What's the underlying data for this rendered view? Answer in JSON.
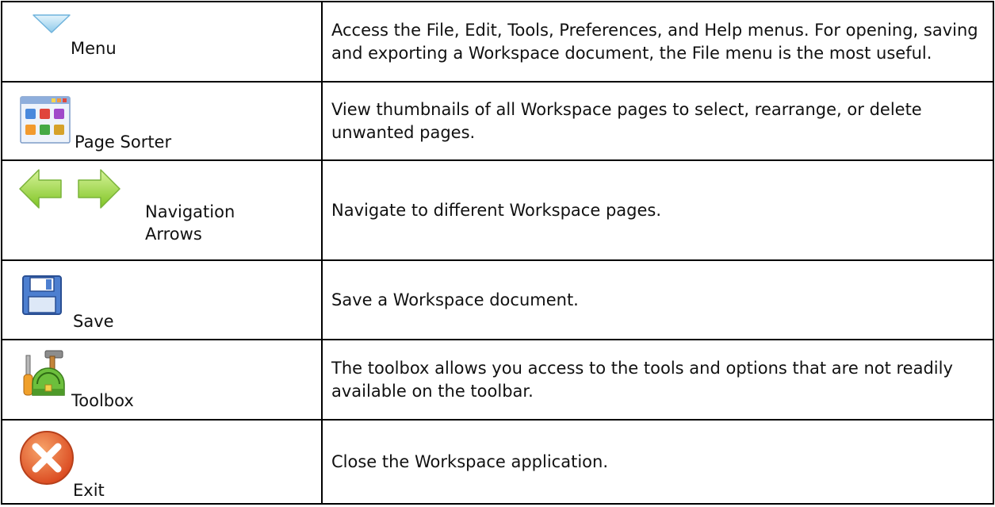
{
  "rows": [
    {
      "tool": "Menu",
      "icon": "menu-dropdown-triangle-icon",
      "description": "Access the File, Edit, Tools, Preferences, and Help menus. For opening, saving and exporting a Workspace document, the File menu is the most useful."
    },
    {
      "tool": "Page Sorter",
      "icon": "page-sorter-grid-icon",
      "description": "View thumbnails of all Workspace pages to select, rearrange, or delete unwanted pages."
    },
    {
      "tool": "Navigation Arrows",
      "icon": "navigation-arrows-icon",
      "description": "Navigate to different Workspace pages."
    },
    {
      "tool": "Save",
      "icon": "floppy-disk-icon",
      "description": "Save a Workspace document."
    },
    {
      "tool": "Toolbox",
      "icon": "toolbox-icon",
      "description": "The toolbox allows you access to the tools and options that are not readily available on the toolbar."
    },
    {
      "tool": "Exit",
      "icon": "exit-close-icon",
      "description": "Close the Workspace application."
    }
  ],
  "colors": {
    "border": "#000000",
    "arrow_green": "#9bd43a",
    "exit_orange": "#e8632b",
    "menu_blue": "#9fd3f0",
    "floppy_blue": "#3d6fc4"
  }
}
